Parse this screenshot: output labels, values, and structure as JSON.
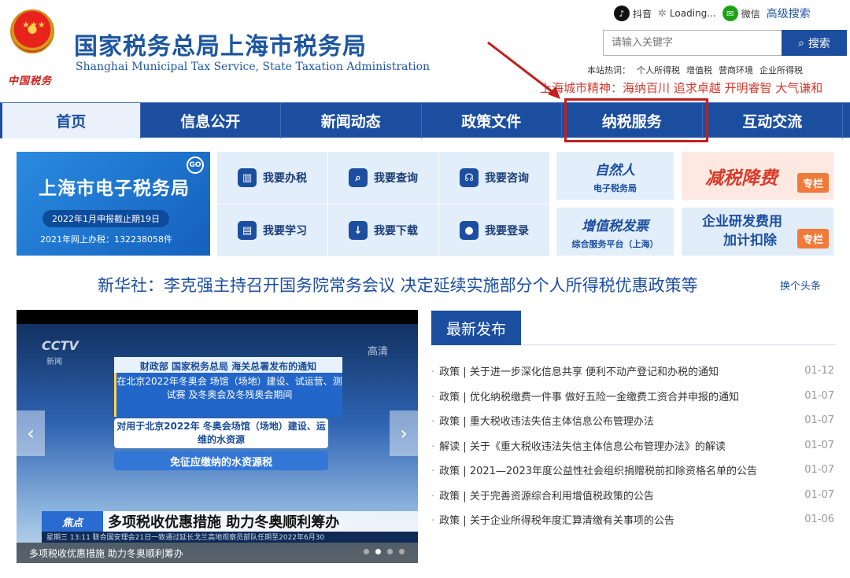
{
  "header": {
    "title": "国家税务总局上海市税务局",
    "subtitle": "Shanghai Municipal Tax Service, State Taxation Administration",
    "emblem_calligraphy": "中国税务"
  },
  "top_links": {
    "douyin": "抖音",
    "loading": "Loading...",
    "wechat": "微信",
    "advanced_search": "高级搜索"
  },
  "search": {
    "placeholder": "请输入关键字",
    "button": "搜索"
  },
  "hotwords": {
    "label": "本站热词：",
    "items": [
      "个人所得税",
      "增值税",
      "营商环境",
      "企业所得税"
    ]
  },
  "city_spirit": "上海城市精神：海纳百川 追求卓越 开明睿智 大气谦和",
  "nav": {
    "items": [
      "首页",
      "信息公开",
      "新闻动态",
      "政策文件",
      "纳税服务",
      "互动交流"
    ]
  },
  "etax": {
    "title": "上海市电子税务局",
    "go": "GO",
    "deadline": "2022年1月申报截止期19日",
    "count": "2021年网上办税：132238058件"
  },
  "services": [
    {
      "label": "我要办税",
      "icon": "building-icon",
      "glyph": "▥"
    },
    {
      "label": "我要查询",
      "icon": "search-doc-icon",
      "glyph": "⌕"
    },
    {
      "label": "我要咨询",
      "icon": "headset-icon",
      "glyph": "☊"
    },
    {
      "label": "我要学习",
      "icon": "book-icon",
      "glyph": "▤"
    },
    {
      "label": "我要下载",
      "icon": "download-icon",
      "glyph": "↓"
    },
    {
      "label": "我要登录",
      "icon": "user-icon",
      "glyph": "●"
    }
  ],
  "promos": {
    "natural_title": "自然人",
    "natural_sub": "电子税务局",
    "vat_title": "增值税发票",
    "vat_sub": "综合服务平台（上海）",
    "reduce_title": "减税降费",
    "rd_line1": "企业研发费用",
    "rd_line2": "加计扣除",
    "zhuanlan": "专栏"
  },
  "headline": {
    "text": "新华社：李克强主持召开国务院常务会议 决定延续实施部分个人所得税优惠政策等",
    "switch": "换个头条"
  },
  "carousel": {
    "logo": "CCTV",
    "logo_sub": "新闻",
    "hd": "高清",
    "slide_headline": "财政部 国家税务总局 海关总署发布的通知",
    "box1_lines": "在北京2022年冬奥会 场馆（场地）建设、试运营、测试赛 及冬奥会及冬残奥会期间",
    "box2_lines": "对用于北京2022年 冬奥会场馆（场地）建设、运维的水资源",
    "box3": "免征应缴纳的水资源税",
    "news_tag": "焦点",
    "news_title": "多项税收优惠措施 助力冬奥顺利筹办",
    "ticker": "星期三  13:11  联合国安理会21日一致通过延长戈兰高地观察员部队任期至2022年6月30",
    "caption": "多项税收优惠措施 助力冬奥顺利筹办",
    "prev": "‹",
    "next": "›",
    "dots": 4,
    "active_dot": 1
  },
  "latest": {
    "title": "最新发布",
    "items": [
      {
        "cat": "政策",
        "title": "关于进一步深化信息共享 便利不动产登记和办税的通知",
        "date": "01-12"
      },
      {
        "cat": "政策",
        "title": "优化纳税缴费一件事 做好五险一金缴费工资合并申报的通知",
        "date": "01-07"
      },
      {
        "cat": "政策",
        "title": "重大税收违法失信主体信息公布管理办法",
        "date": "01-07"
      },
      {
        "cat": "解读",
        "title": "关于《重大税收违法失信主体信息公布管理办法》的解读",
        "date": "01-07"
      },
      {
        "cat": "政策",
        "title": "2021—2023年度公益性社会组织捐赠税前扣除资格名单的公告",
        "date": "01-07"
      },
      {
        "cat": "政策",
        "title": "关于完善资源综合利用增值税政策的公告",
        "date": "01-07"
      },
      {
        "cat": "政策",
        "title": "关于企业所得税年度汇算清缴有关事项的公告",
        "date": "01-06"
      }
    ]
  },
  "colors": {
    "brand_blue": "#1c4ea0",
    "accent_red": "#c21f1f"
  }
}
